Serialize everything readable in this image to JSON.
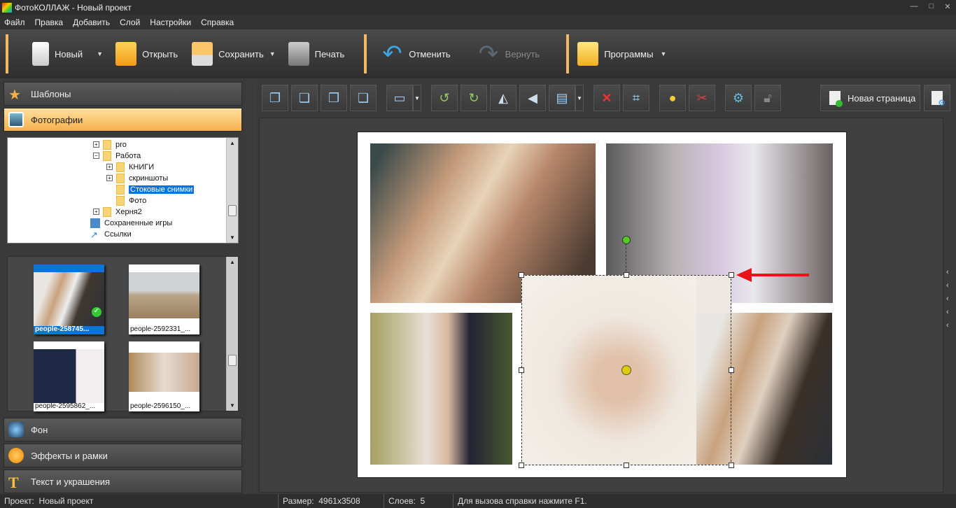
{
  "window": {
    "title": "ФотоКОЛЛАЖ - Новый проект"
  },
  "menu": [
    "Файл",
    "Правка",
    "Добавить",
    "Слой",
    "Настройки",
    "Справка"
  ],
  "toolbar": {
    "new": "Новый",
    "open": "Открыть",
    "save": "Сохранить",
    "print": "Печать",
    "undo": "Отменить",
    "redo": "Вернуть",
    "programs": "Программы"
  },
  "panels": {
    "templates": "Шаблоны",
    "photos": "Фотографии",
    "background": "Фон",
    "effects": "Эффекты и рамки",
    "text": "Текст и украшения"
  },
  "tree": {
    "items": [
      {
        "label": "pro",
        "expander": "+"
      },
      {
        "label": "Работа",
        "expander": "−"
      },
      {
        "label": "КНИГИ",
        "expander": "+"
      },
      {
        "label": "скриншоты",
        "expander": "+"
      },
      {
        "label": "Стоковые снимки",
        "selected": true
      },
      {
        "label": "Фото"
      },
      {
        "label": "Херня2",
        "expander": "+"
      },
      {
        "label": "Сохраненные игры"
      },
      {
        "label": "Ссылки"
      }
    ]
  },
  "thumbnails": [
    {
      "name": "people-258745...",
      "selected": true,
      "checked": true
    },
    {
      "name": "people-2592331_..."
    },
    {
      "name": "people-2595862_..."
    },
    {
      "name": "people-2596150_..."
    }
  ],
  "canvas_toolbar": {
    "new_page": "Новая страница"
  },
  "status": {
    "project_label": "Проект:",
    "project": "Новый проект",
    "size_label": "Размер:",
    "size": "4961x3508",
    "layers_label": "Слоев:",
    "layers": "5",
    "hint": "Для вызова справки нажмите F1."
  },
  "colors": {
    "accent": "#f6b04a",
    "selection": "#0a74d8",
    "arrow": "#e8141a"
  }
}
